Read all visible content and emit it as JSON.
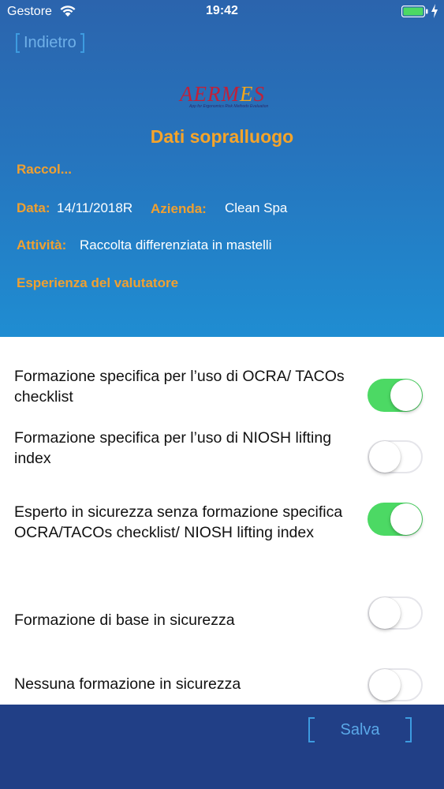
{
  "status": {
    "carrier": "Gestore",
    "time": "19:42"
  },
  "nav": {
    "back_label": "Indietro"
  },
  "logo": {
    "text_a": "AERM",
    "text_e": "E",
    "text_b": "S",
    "tagline": "App for Ergonomics Risk Methods Evaluation"
  },
  "page": {
    "title": "Dati sopralluogo",
    "short_name": "Raccol...",
    "date_label": "Data:",
    "date_value": "14/11/2018R",
    "company_label": "Azienda:",
    "company_value": "Clean Spa",
    "activity_label": "Attività:",
    "activity_value": "Raccolta differenziata in mastelli",
    "section_label": "Esperienza del valutatore"
  },
  "options": [
    {
      "label": "Formazione specifica per l’uso di OCRA/ TACOs checklist",
      "on": true
    },
    {
      "label": "Formazione specifica per l’uso di NIOSH lifting index",
      "on": false
    },
    {
      "label": "Esperto in sicurezza senza formazione specifica OCRA/TACOs checklist/ NIOSH lifting index",
      "on": true
    },
    {
      "label": "Formazione di base in sicurezza",
      "on": false
    },
    {
      "label": "Nessuna formazione in sicurezza",
      "on": false
    }
  ],
  "footer": {
    "save_label": "Salva"
  },
  "colors": {
    "header_top": "#2b64ad",
    "accent_orange": "#f0a030",
    "toggle_on": "#4cd964",
    "footer": "#213f86"
  }
}
